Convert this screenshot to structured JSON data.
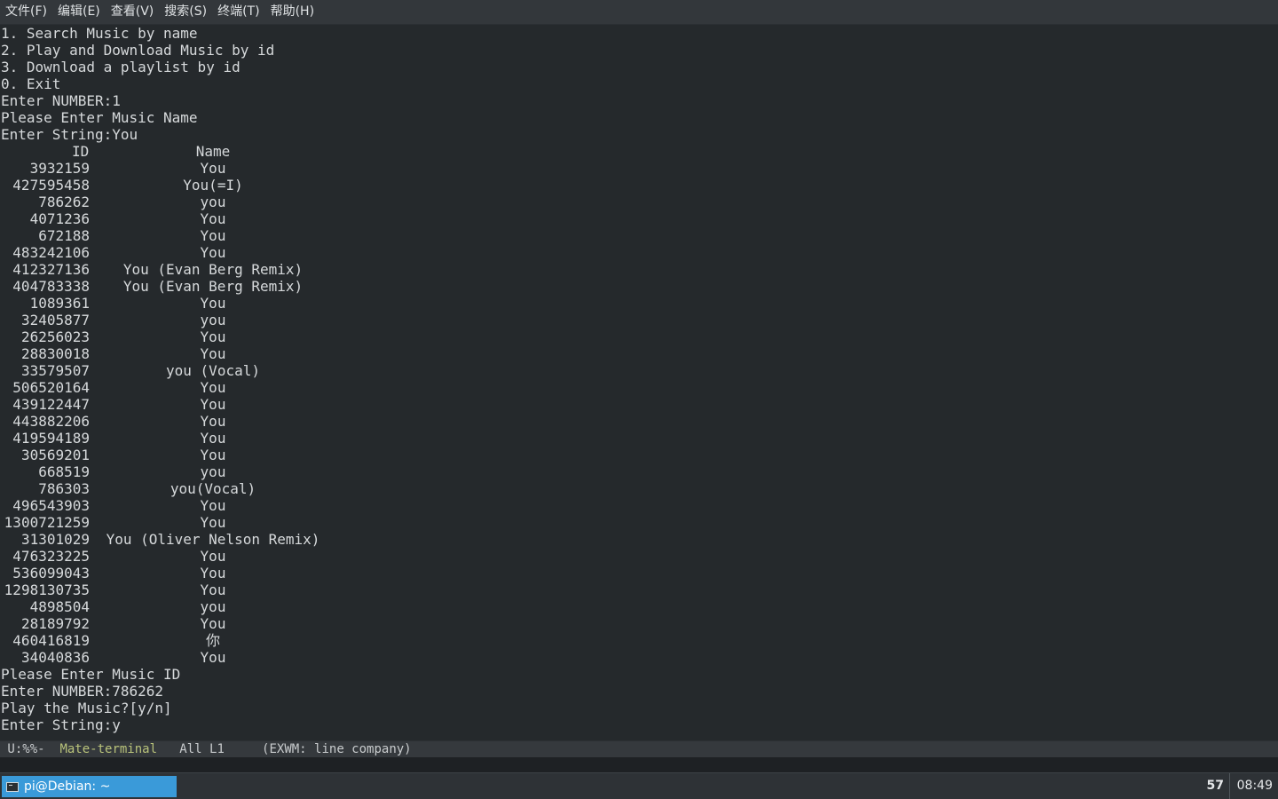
{
  "menu": [
    "文件(F)",
    "编辑(E)",
    "查看(V)",
    "搜索(S)",
    "终端(T)",
    "帮助(H)"
  ],
  "terminal": {
    "intro_lines": [
      "1. Search Music by name",
      "2. Play and Download Music by id",
      "3. Download a playlist by id",
      "0. Exit",
      "Enter NUMBER:1",
      "Please Enter Music Name",
      "Enter String:You"
    ],
    "table": {
      "headers": {
        "id": "ID",
        "name": "Name"
      },
      "rows": [
        {
          "id": "3932159",
          "name": "You"
        },
        {
          "id": "427595458",
          "name": "You(=I)"
        },
        {
          "id": "786262",
          "name": "you"
        },
        {
          "id": "4071236",
          "name": "You"
        },
        {
          "id": "672188",
          "name": "You"
        },
        {
          "id": "483242106",
          "name": "You"
        },
        {
          "id": "412327136",
          "name": "You (Evan Berg Remix)"
        },
        {
          "id": "404783338",
          "name": "You (Evan Berg Remix)"
        },
        {
          "id": "1089361",
          "name": "You"
        },
        {
          "id": "32405877",
          "name": "you"
        },
        {
          "id": "26256023",
          "name": "You"
        },
        {
          "id": "28830018",
          "name": "You"
        },
        {
          "id": "33579507",
          "name": "you (Vocal)"
        },
        {
          "id": "506520164",
          "name": "You"
        },
        {
          "id": "439122447",
          "name": "You"
        },
        {
          "id": "443882206",
          "name": "You"
        },
        {
          "id": "419594189",
          "name": "You"
        },
        {
          "id": "30569201",
          "name": "You"
        },
        {
          "id": "668519",
          "name": "you"
        },
        {
          "id": "786303",
          "name": "you(Vocal)"
        },
        {
          "id": "496543903",
          "name": "You"
        },
        {
          "id": "1300721259",
          "name": "You"
        },
        {
          "id": "31301029",
          "name": "You (Oliver Nelson Remix)"
        },
        {
          "id": "476323225",
          "name": "You"
        },
        {
          "id": "536099043",
          "name": "You"
        },
        {
          "id": "1298130735",
          "name": "You"
        },
        {
          "id": "4898504",
          "name": "you"
        },
        {
          "id": "28189792",
          "name": "You"
        },
        {
          "id": "460416819",
          "name": "你"
        },
        {
          "id": "34040836",
          "name": "You"
        }
      ]
    },
    "outro_lines": [
      "Please Enter Music ID",
      "Enter NUMBER:786262",
      "Play the Music?[y/n]",
      "Enter String:y"
    ]
  },
  "modeline": {
    "status": " U:%%-  ",
    "buffer": "Mate-terminal",
    "position": "   All L1     ",
    "mode": "(EXWM: line company)"
  },
  "taskbar": {
    "task_label": "pi@Debian: ~",
    "count": "57",
    "clock": "08:49"
  },
  "colors": {
    "terminal_bg": "#25292c",
    "text": "#d6d9db",
    "task_active": "#3a9ad9",
    "modeline_buffer": "#b8c27a"
  },
  "icons": [
    "terminal-icon"
  ]
}
